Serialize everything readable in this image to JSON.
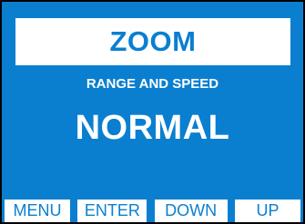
{
  "screen": {
    "title": "ZOOM",
    "subtitle": "RANGE AND SPEED",
    "value": "NORMAL"
  },
  "softkeys": [
    {
      "label": "MENU"
    },
    {
      "label": "ENTER"
    },
    {
      "label": "DOWN"
    },
    {
      "label": "UP"
    }
  ],
  "colors": {
    "background": "#0a7fd0",
    "accent": "#ffffff"
  }
}
